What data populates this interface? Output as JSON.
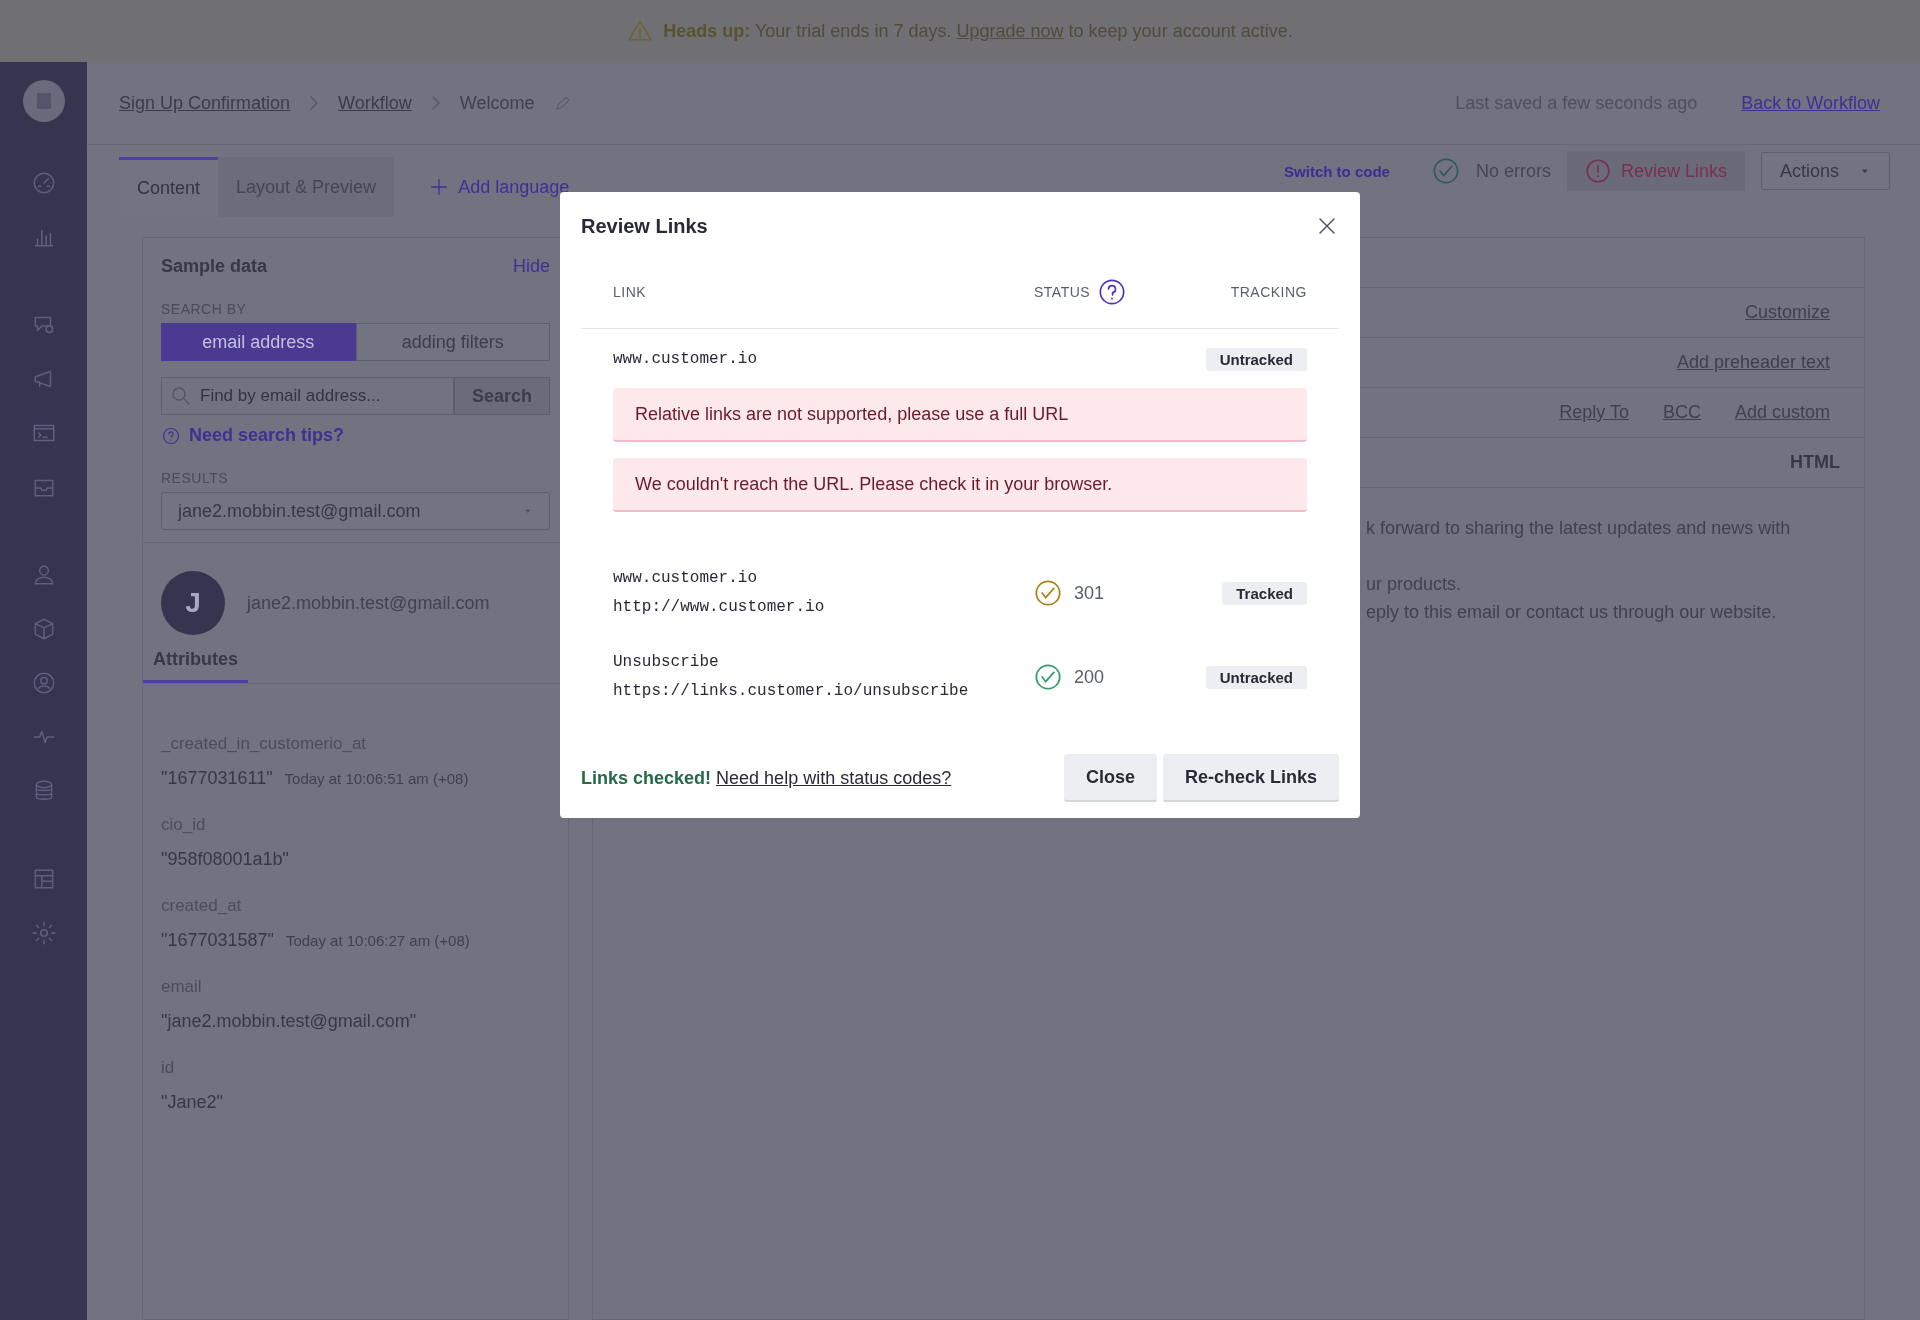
{
  "banner": {
    "message_start": "**Heads up:** Your trial ends in 7 days.",
    "link": "Upgrade now",
    "message_end": "to keep your account active."
  },
  "breadcrumbs": [
    {
      "label": "Sign Up Confirmation",
      "kind": "link"
    },
    {
      "label": "Workflow",
      "kind": "link"
    },
    {
      "label": "Welcome",
      "kind": "current"
    }
  ],
  "last_saved": "Last saved a few seconds ago",
  "back_link": "Back to Workflow",
  "tabs": [
    {
      "label": "Content",
      "selected": true
    },
    {
      "label": "Layout & Preview",
      "selected": false
    }
  ],
  "add_language": "Add language",
  "toolbar": {
    "switch_to_code": "Switch to code",
    "status": "No errors",
    "review_links": "Review Links",
    "actions": "Actions"
  },
  "sample_data": {
    "title": "Sample data",
    "hide": "Hide",
    "search_by": "SEARCH BY",
    "segments": [
      {
        "label": "email address",
        "selected": true
      },
      {
        "label": "adding filters",
        "selected": false
      }
    ],
    "search_placeholder": "Find by email address...",
    "search_button": "Search",
    "tips": "Need search tips?",
    "results_label": "RESULTS",
    "result": "jane2.mobbin.test@gmail.com",
    "profile": {
      "initial": "J",
      "email": "jane2.mobbin.test@gmail.com"
    },
    "attributes_tab": "Attributes",
    "attributes": [
      {
        "name": "_created_in_customerio_at",
        "value": "\"1677031611\"",
        "time": "Today at 10:06:51 am (+08)"
      },
      {
        "name": "cio_id",
        "value": "\"958f08001a1b\""
      },
      {
        "name": "created_at",
        "value": "\"1677031587\"",
        "time": "Today at 10:06:27 am (+08)"
      },
      {
        "name": "email",
        "value": "\"jane2.mobbin.test@gmail.com\""
      },
      {
        "name": "id",
        "value": "\"Jane2\""
      }
    ]
  },
  "email_panel": {
    "link_rows": [
      [
        "Customize"
      ],
      [
        "Add preheader text"
      ],
      [
        "Reply To",
        "BCC",
        "Add custom"
      ]
    ],
    "format": "HTML",
    "body_lines": [
      "k forward to sharing the latest updates and news with",
      "ur products.",
      "eply to this email or contact us through our website."
    ]
  },
  "modal": {
    "title": "Review Links",
    "columns": [
      "LINK",
      "STATUS",
      "TRACKING"
    ],
    "links": [
      {
        "kind": "error",
        "url": "www.customer.io",
        "tracking": "Untracked",
        "errors": [
          "Relative links are not supported, please use a full URL",
          "We couldn't reach the URL. Please check it in your browser."
        ]
      },
      {
        "kind": "ok",
        "name": "www.customer.io",
        "url": "http://www.customer.io",
        "code": "301",
        "color": "#a8841a",
        "tracking": "Tracked"
      },
      {
        "kind": "ok",
        "name": "Unsubscribe",
        "url": "https://links.customer.io/unsubscribe",
        "code": "200",
        "color": "#2f9e6b",
        "tracking": "Untracked"
      }
    ],
    "status_text": "Links checked!",
    "help_link": "Need help with status codes?",
    "buttons": [
      "Close",
      "Re-check Links"
    ]
  }
}
